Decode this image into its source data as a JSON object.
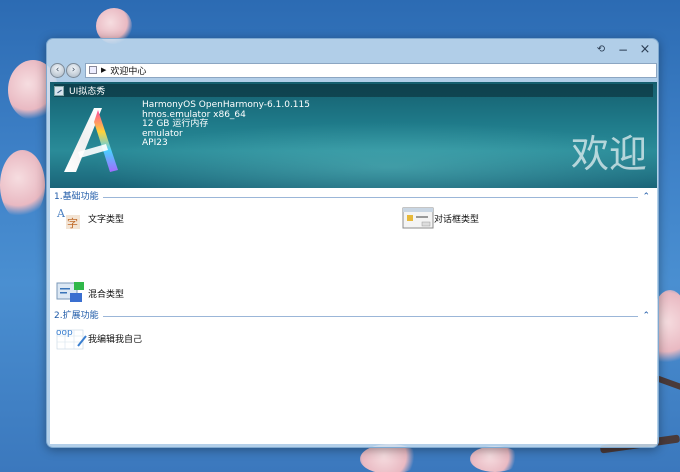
{
  "window": {
    "controls": {
      "restore": "⟲",
      "minimize": "−",
      "close": "×"
    }
  },
  "addressbar": {
    "back_icon": "arrow-left-icon",
    "forward_icon": "arrow-right-icon",
    "path_separator": "▶",
    "path": "欢迎中心"
  },
  "banner": {
    "app_title": "UI拟态秀",
    "sysinfo": {
      "os": "HarmonyOS OpenHarmony-6.1.0.115",
      "device": "hmos.emulator x86_64",
      "memory": "12 GB 运行内存",
      "type": "emulator",
      "api": "API23"
    },
    "welcome": "欢迎"
  },
  "sections": [
    {
      "title": "1.基础功能",
      "chevron": "⌃",
      "items": [
        {
          "label": "文字类型",
          "icon": "text-type-icon"
        },
        {
          "label": "对话框类型",
          "icon": "dialog-type-icon"
        },
        {
          "label": "混合类型",
          "icon": "mixed-type-icon"
        }
      ]
    },
    {
      "title": "2.扩展功能",
      "chevron": "⌃",
      "items": [
        {
          "label": "我编辑我自己",
          "icon": "self-edit-icon"
        }
      ]
    }
  ],
  "colors": {
    "accent": "#1e5aa8",
    "banner": "#1f7b8a"
  }
}
